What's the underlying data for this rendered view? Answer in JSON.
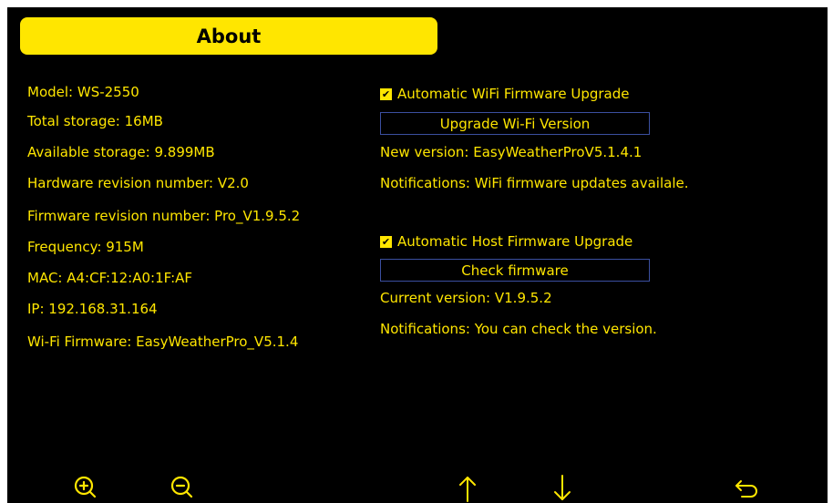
{
  "title": "About",
  "device_info": [
    "Model: WS-2550",
    "Total storage: 16MB",
    "Available storage: 9.899MB",
    "Hardware revision number: V2.0",
    "Firmware revision number: Pro_V1.9.5.2",
    "Frequency: 915M",
    "MAC: A4:CF:12:A0:1F:AF",
    "IP: 192.168.31.164",
    "Wi-Fi Firmware: EasyWeatherPro_V5.1.4"
  ],
  "wifi_upgrade": {
    "checkbox_label": "Automatic WiFi Firmware Upgrade",
    "checked": true,
    "button_label": "Upgrade Wi-Fi Version",
    "new_version": "New version: EasyWeatherProV5.1.4.1",
    "notification": "Notifications: WiFi firmware updates availale."
  },
  "host_upgrade": {
    "checkbox_label": "Automatic Host Firmware Upgrade",
    "checked": true,
    "button_label": "Check firmware",
    "current_version": "Current version: V1.9.5.2",
    "notification": "Notifications: You can check the version."
  },
  "toolbar": {
    "icons": [
      "zoom-in-icon",
      "zoom-out-icon",
      "arrow-up-icon",
      "arrow-down-icon",
      "back-icon"
    ]
  },
  "colors": {
    "accent": "#ffe600",
    "background": "#000000",
    "button_border": "#3b4fa0"
  }
}
